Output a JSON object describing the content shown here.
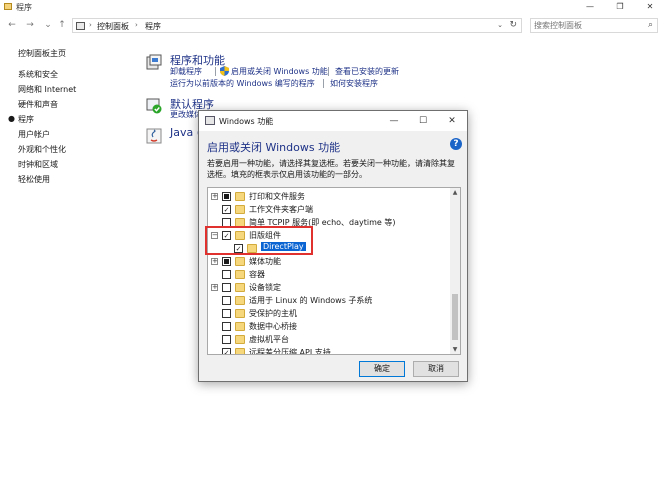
{
  "window": {
    "title": "程序"
  },
  "address": {
    "crumbs": [
      "控制面板",
      "程序"
    ],
    "search_placeholder": "搜索控制面板"
  },
  "leftnav": {
    "items": [
      {
        "label": "控制面板主页",
        "active": false
      },
      {
        "label": "系统和安全",
        "active": false
      },
      {
        "label": "网络和 Internet",
        "active": false
      },
      {
        "label": "硬件和声音",
        "active": false
      },
      {
        "label": "程序",
        "active": true
      },
      {
        "label": "用户帐户",
        "active": false
      },
      {
        "label": "外观和个性化",
        "active": false
      },
      {
        "label": "时钟和区域",
        "active": false
      },
      {
        "label": "轻松使用",
        "active": false
      }
    ]
  },
  "content": {
    "programs": {
      "title": "程序和功能",
      "links": [
        "卸载程序",
        "启用或关闭 Windows 功能",
        "查看已安装的更新",
        "运行为以前版本的 Windows 编写的程序",
        "如何安装程序"
      ]
    },
    "defaults": {
      "title": "默认程序",
      "link": "更改媒体"
    },
    "java": {
      "title": "Java ("
    }
  },
  "dialog": {
    "title": "Windows 功能",
    "heading": "启用或关闭 Windows 功能",
    "description": "若要启用一种功能，请选择其复选框。若要关闭一种功能，请清除其复选框。填充的框表示仅启用该功能的一部分。",
    "features": [
      {
        "label": "打印和文件服务",
        "expander": "+",
        "state": "partial"
      },
      {
        "label": "工作文件夹客户端",
        "expander": "",
        "state": "checked"
      },
      {
        "label": "简单 TCPIP 服务(即 echo、daytime 等)",
        "expander": "",
        "state": "unchecked"
      },
      {
        "label": "旧版组件",
        "expander": "−",
        "state": "checked"
      },
      {
        "label": "DirectPlay",
        "expander": "",
        "state": "checked",
        "child": true,
        "selected": true
      },
      {
        "label": "媒体功能",
        "expander": "+",
        "state": "partial"
      },
      {
        "label": "容器",
        "expander": "",
        "state": "unchecked"
      },
      {
        "label": "设备锁定",
        "expander": "+",
        "state": "unchecked"
      },
      {
        "label": "适用于 Linux 的 Windows 子系统",
        "expander": "",
        "state": "unchecked"
      },
      {
        "label": "受保护的主机",
        "expander": "",
        "state": "unchecked"
      },
      {
        "label": "数据中心桥接",
        "expander": "",
        "state": "unchecked"
      },
      {
        "label": "虚拟机平台",
        "expander": "",
        "state": "unchecked"
      },
      {
        "label": "远程差分压缩 API 支持",
        "expander": "",
        "state": "checked"
      }
    ],
    "ok_label": "确定",
    "cancel_label": "取消"
  },
  "colors": {
    "link": "#1e3287",
    "selection": "#0a64d2",
    "highlight_box": "#e0312f"
  }
}
